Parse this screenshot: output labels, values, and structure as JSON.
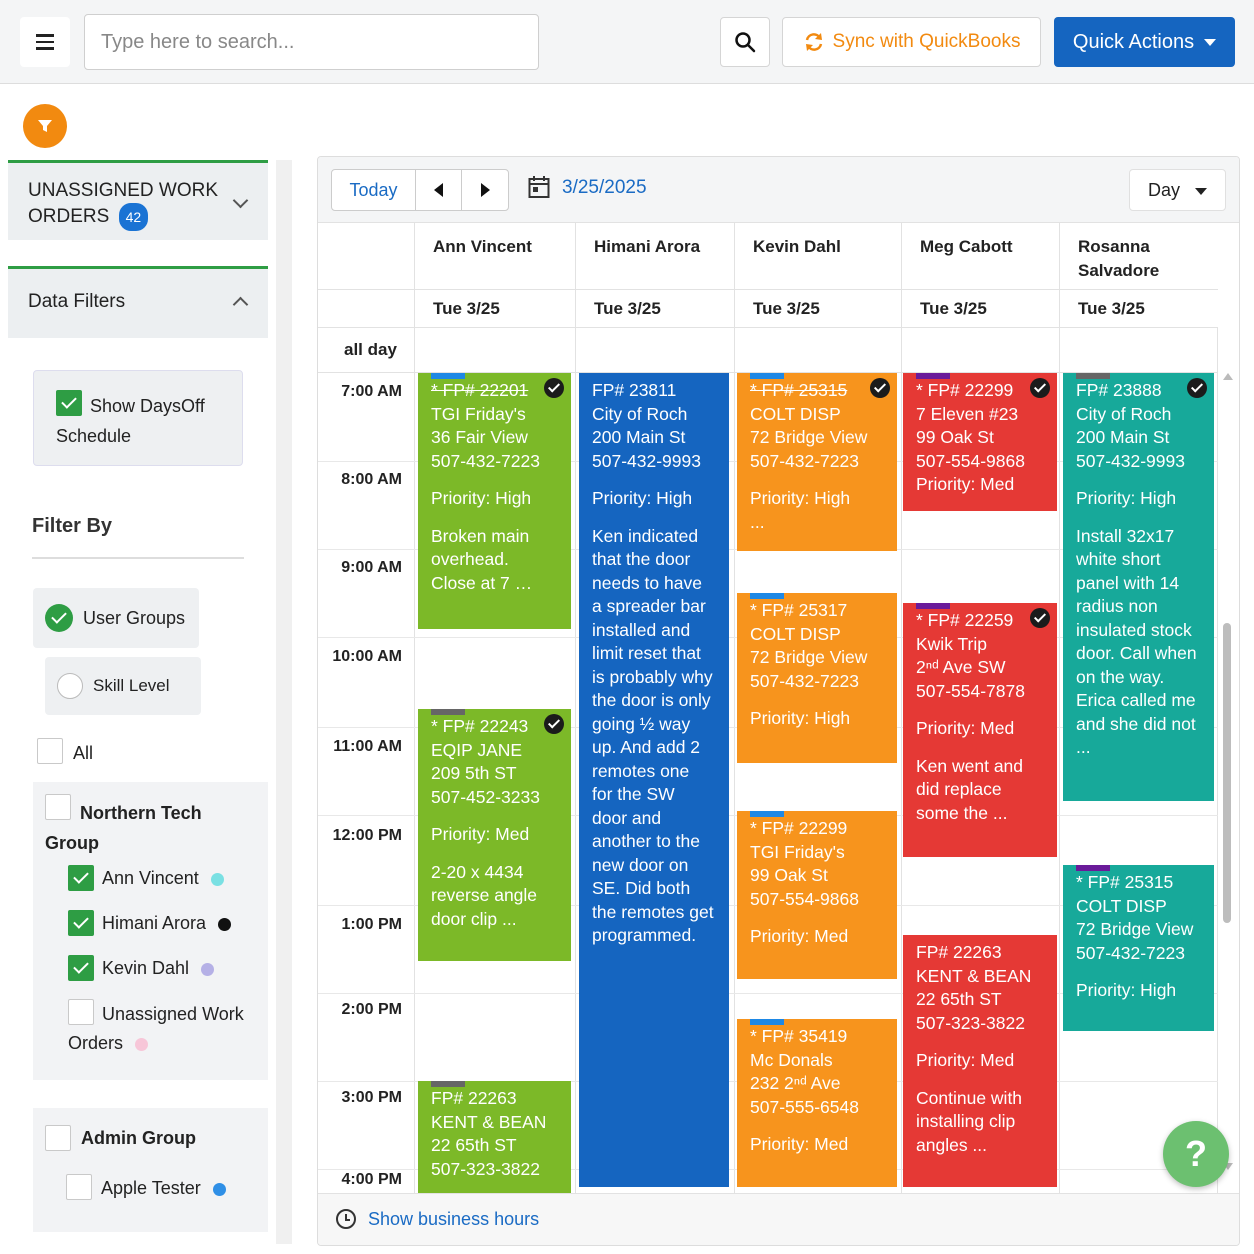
{
  "topbar": {
    "search_placeholder": "Type here to search...",
    "sync_label": "Sync with QuickBooks",
    "quick_actions_label": "Quick Actions"
  },
  "sidebar": {
    "unassigned": {
      "title_line1": "UNASSIGNED WORK",
      "title_line2": "ORDERS",
      "count": "42"
    },
    "data_filters_title": "Data Filters",
    "show_daysoff_label": "Show DaysOff Schedule",
    "filter_by_title": "Filter By",
    "user_groups_label": "User Groups",
    "skill_level_label": "Skill Level",
    "all_label": "All",
    "groups": [
      {
        "name": "Northern Tech Group",
        "members": [
          {
            "name": "Ann Vincent",
            "color": "#7ae0e3"
          },
          {
            "name": "Himani Arora",
            "color": "#111111"
          },
          {
            "name": "Kevin Dahl",
            "color": "#b5b0e6"
          },
          {
            "name": "Unassigned Work Orders",
            "color": "#f7c6d8"
          }
        ]
      },
      {
        "name": "Admin Group",
        "members": [
          {
            "name": "Apple Tester",
            "color": "#2f8fe6"
          }
        ]
      }
    ]
  },
  "calendar": {
    "today_label": "Today",
    "date_label": "3/25/2025",
    "view_label": "Day",
    "all_day_label": "all day",
    "footer_label": "Show business hours",
    "columns": [
      {
        "name": "Ann Vincent",
        "day": "Tue 3/25"
      },
      {
        "name": "Himani Arora",
        "day": "Tue 3/25"
      },
      {
        "name": "Kevin Dahl",
        "day": "Tue 3/25"
      },
      {
        "name": "Meg Cabott",
        "day": "Tue 3/25"
      },
      {
        "name": "Rosanna Salvadore",
        "day": "Tue 3/25"
      }
    ],
    "times": [
      "7:00 AM",
      "8:00 AM",
      "9:00 AM",
      "10:00 AM",
      "11:00 AM",
      "12:00 PM",
      "1:00 PM",
      "2:00 PM",
      "3:00 PM",
      "4:00 PM"
    ],
    "events": {
      "e1": {
        "lines": [
          "* FP# 22201",
          "TGI Friday's",
          "36 Fair View",
          "507-432-7223"
        ],
        "priority": "Priority: High",
        "note": "Broken main overhead. Close at 7 …",
        "tag_color": "#1e88e5"
      },
      "e2": {
        "lines": [
          "* FP# 22243",
          "EQIP JANE",
          "209 5th ST",
          "507-452-3233"
        ],
        "priority": "Priority: Med",
        "note": "2-20 x 4434 reverse angle door clip ...",
        "tag_color": "#666666"
      },
      "e3": {
        "lines": [
          "FP# 22263",
          "KENT & BEAN",
          "22 65th ST",
          "507-323-3822"
        ],
        "tag_color": "#666666"
      },
      "e4": {
        "lines": [
          "FP# 23811",
          "City of Roch",
          "200 Main St",
          "507-432-9993"
        ],
        "priority": "Priority: High",
        "note": "Ken indicated that the door needs to have a spreader bar installed and limit reset that is probably why the door is only going ½ way up. And add 2 remotes one for the SW door and another to the new door on SE. Did both the remotes get programmed."
      },
      "e5": {
        "lines": [
          "* FP# 25315",
          "COLT DISP",
          "72 Bridge View",
          "507-432-7223"
        ],
        "priority": "Priority: High",
        "note": "...",
        "tag_color": "#1e88e5"
      },
      "e6": {
        "lines": [
          "* FP# 25317",
          "COLT DISP",
          "72 Bridge View",
          "507-432-7223"
        ],
        "priority": "Priority: High",
        "tag_color": "#1e88e5"
      },
      "e7": {
        "lines": [
          "* FP# 22299",
          "TGI Friday's",
          "99 Oak St",
          "507-554-9868"
        ],
        "priority": "Priority: Med",
        "tag_color": "#1e88e5"
      },
      "e8": {
        "lines": [
          "* FP# 35419",
          "Mc Donals",
          "232 2ⁿᵈ Ave",
          "507-555-6548"
        ],
        "priority": "Priority: Med",
        "tag_color": "#1e88e5"
      },
      "e9": {
        "lines": [
          "* FP# 22299",
          "7 Eleven #23",
          "99 Oak St",
          "507-554-9868",
          "Priority: Med"
        ],
        "tag_color": "#6a1b9a"
      },
      "e10": {
        "lines": [
          "* FP# 22259",
          "Kwik Trip",
          "2ⁿᵈ Ave SW",
          "507-554-7878"
        ],
        "priority": "Priority: Med",
        "note": "Ken went and did replace some the ...",
        "tag_color": "#6a1b9a"
      },
      "e11": {
        "lines": [
          "FP# 22263",
          "KENT & BEAN",
          "22 65th ST",
          "507-323-3822"
        ],
        "priority": "Priority: Med",
        "note": "Continue with installing clip angles ..."
      },
      "e12": {
        "lines": [
          "FP# 23888",
          "City of Roch",
          "200 Main St",
          "507-432-9993"
        ],
        "priority": "Priority: High",
        "note": "Install 32x17 white short panel with 14 radius non insulated stock door. Call when on the way. Erica called me and she did not ...",
        "tag_color": "#666666"
      },
      "e13": {
        "lines": [
          "* FP# 25315",
          "COLT DISP",
          "72 Bridge View",
          "507-432-7223"
        ],
        "priority": "Priority: High",
        "tag_color": "#6a1b9a"
      }
    }
  },
  "help_label": "?"
}
